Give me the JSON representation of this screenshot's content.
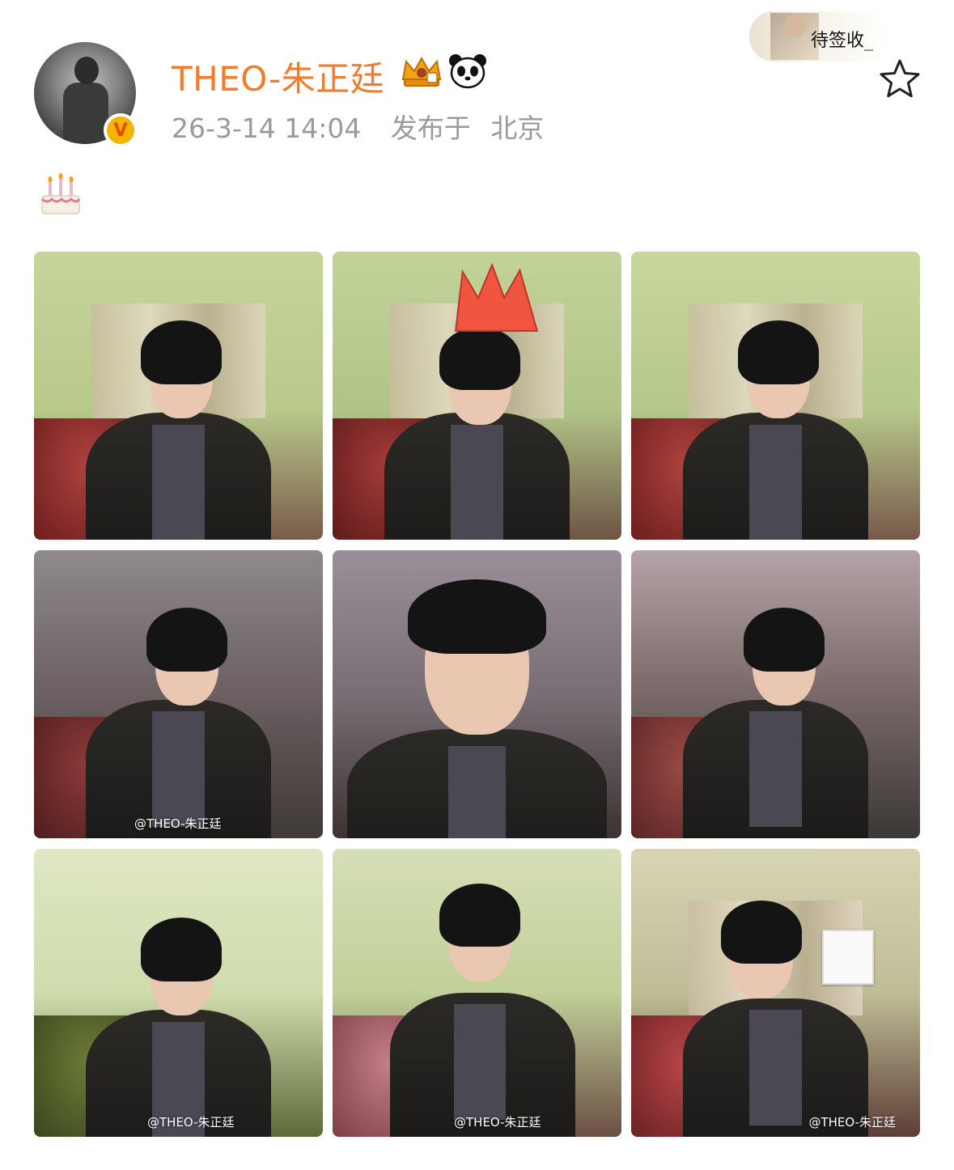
{
  "post": {
    "username": "THEO-朱正廷",
    "timestamp": "26-3-14 14:04",
    "location_prefix": "发布于",
    "location": "北京",
    "verified_badge": "V",
    "badges": [
      "crown-icon",
      "panda-icon"
    ],
    "body_emoji": "🎂",
    "follow_card_label": "待签收_"
  },
  "colors": {
    "username": "#f47b2a",
    "meta": "#9a9a9a",
    "verified_badge_bg": "#f5b400"
  },
  "gallery": {
    "photos": [
      {
        "id": 1,
        "watermark": ""
      },
      {
        "id": 2,
        "watermark": ""
      },
      {
        "id": 3,
        "watermark": ""
      },
      {
        "id": 4,
        "watermark": "@THEO-朱正廷"
      },
      {
        "id": 5,
        "watermark": ""
      },
      {
        "id": 6,
        "watermark": ""
      },
      {
        "id": 7,
        "watermark": ""
      },
      {
        "id": 8,
        "watermark": "@THEO-朱正廷"
      },
      {
        "id": 9,
        "watermark": "@THEO-朱正廷"
      }
    ],
    "watermark_text": "@THEO-朱正廷",
    "watermark_text_2": "@THEO-朱正廷",
    "watermark_text_3": "@THEO-朱正廷"
  }
}
